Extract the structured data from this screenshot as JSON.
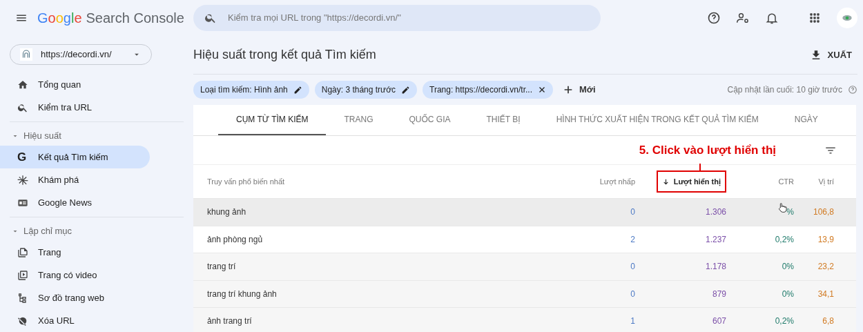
{
  "header": {
    "product_name": "Search Console",
    "logo_word": "Google",
    "search": {
      "placeholder": "Kiểm tra mọi URL trong \"https://decordi.vn/\""
    }
  },
  "sidebar": {
    "property": "https://decordi.vn/",
    "sections": [
      {
        "kind": "plain",
        "items": [
          {
            "label": "Tổng quan",
            "selected": false
          },
          {
            "label": "Kiểm tra URL",
            "selected": false
          }
        ]
      },
      {
        "kind": "group",
        "title": "Hiệu suất",
        "expanded": true,
        "items": [
          {
            "label": "Kết quả Tìm kiếm",
            "icon_text": "G",
            "selected": true
          },
          {
            "label": "Khám phá",
            "selected": false
          },
          {
            "label": "Google News",
            "selected": false
          }
        ]
      },
      {
        "kind": "group",
        "title": "Lập chỉ mục",
        "expanded": true,
        "items": [
          {
            "label": "Trang",
            "selected": false
          },
          {
            "label": "Trang có video",
            "selected": false
          },
          {
            "label": "Sơ đồ trang web",
            "selected": false
          },
          {
            "label": "Xóa URL",
            "selected": false
          }
        ]
      }
    ]
  },
  "page": {
    "title": "Hiệu suất trong kết quả Tìm kiếm",
    "export_label": "XUẤT",
    "filters": [
      {
        "label": "Loại tìm kiếm: Hình ảnh",
        "kind": "edit"
      },
      {
        "label": "Ngày: 3 tháng trước",
        "kind": "edit"
      },
      {
        "label": "Trang: https://decordi.vn/tr...",
        "kind": "remove"
      }
    ],
    "new_filter": "Mới",
    "last_updated": "Cập nhật lần cuối: 10 giờ trước",
    "tabs": [
      {
        "label": "CỤM TỪ TÌM KIẾM",
        "selected": true
      },
      {
        "label": "TRANG",
        "selected": false
      },
      {
        "label": "QUỐC GIA",
        "selected": false
      },
      {
        "label": "THIẾT BỊ",
        "selected": false
      },
      {
        "label": "HÌNH THỨC XUẤT HIỆN TRONG KẾT QUẢ TÌM KIẾM",
        "selected": false
      },
      {
        "label": "NGÀY",
        "selected": false
      }
    ],
    "annotation": "5. Click vào lượt hiển thị",
    "table": {
      "columns": [
        {
          "label": "Truy vấn phổ biến nhất",
          "kind": "query",
          "sorted": false,
          "highlighted": false
        },
        {
          "label": "Lượt nhấp",
          "kind": "clicks",
          "sorted": false,
          "highlighted": false
        },
        {
          "label": "Lượt hiển thị",
          "kind": "impressions",
          "sorted": true,
          "highlighted": true
        },
        {
          "label": "CTR",
          "kind": "ctr",
          "sorted": false,
          "highlighted": false
        },
        {
          "label": "Vị trí",
          "kind": "position",
          "sorted": false,
          "highlighted": false
        }
      ],
      "rows": [
        {
          "cells": [
            "khung ảnh",
            "0",
            "1.306",
            "%",
            "106,8"
          ],
          "hovered": true
        },
        {
          "cells": [
            "ảnh phòng ngủ",
            "2",
            "1.237",
            "0,2%",
            "13,9"
          ],
          "hovered": false
        },
        {
          "cells": [
            "trang trí",
            "0",
            "1.178",
            "0%",
            "23,2"
          ],
          "hovered": false
        },
        {
          "cells": [
            "trang trí khung ảnh",
            "0",
            "879",
            "0%",
            "34,1"
          ],
          "hovered": false
        },
        {
          "cells": [
            "ảnh trang trí",
            "1",
            "607",
            "0,2%",
            "6,8"
          ],
          "hovered": false
        }
      ]
    }
  }
}
